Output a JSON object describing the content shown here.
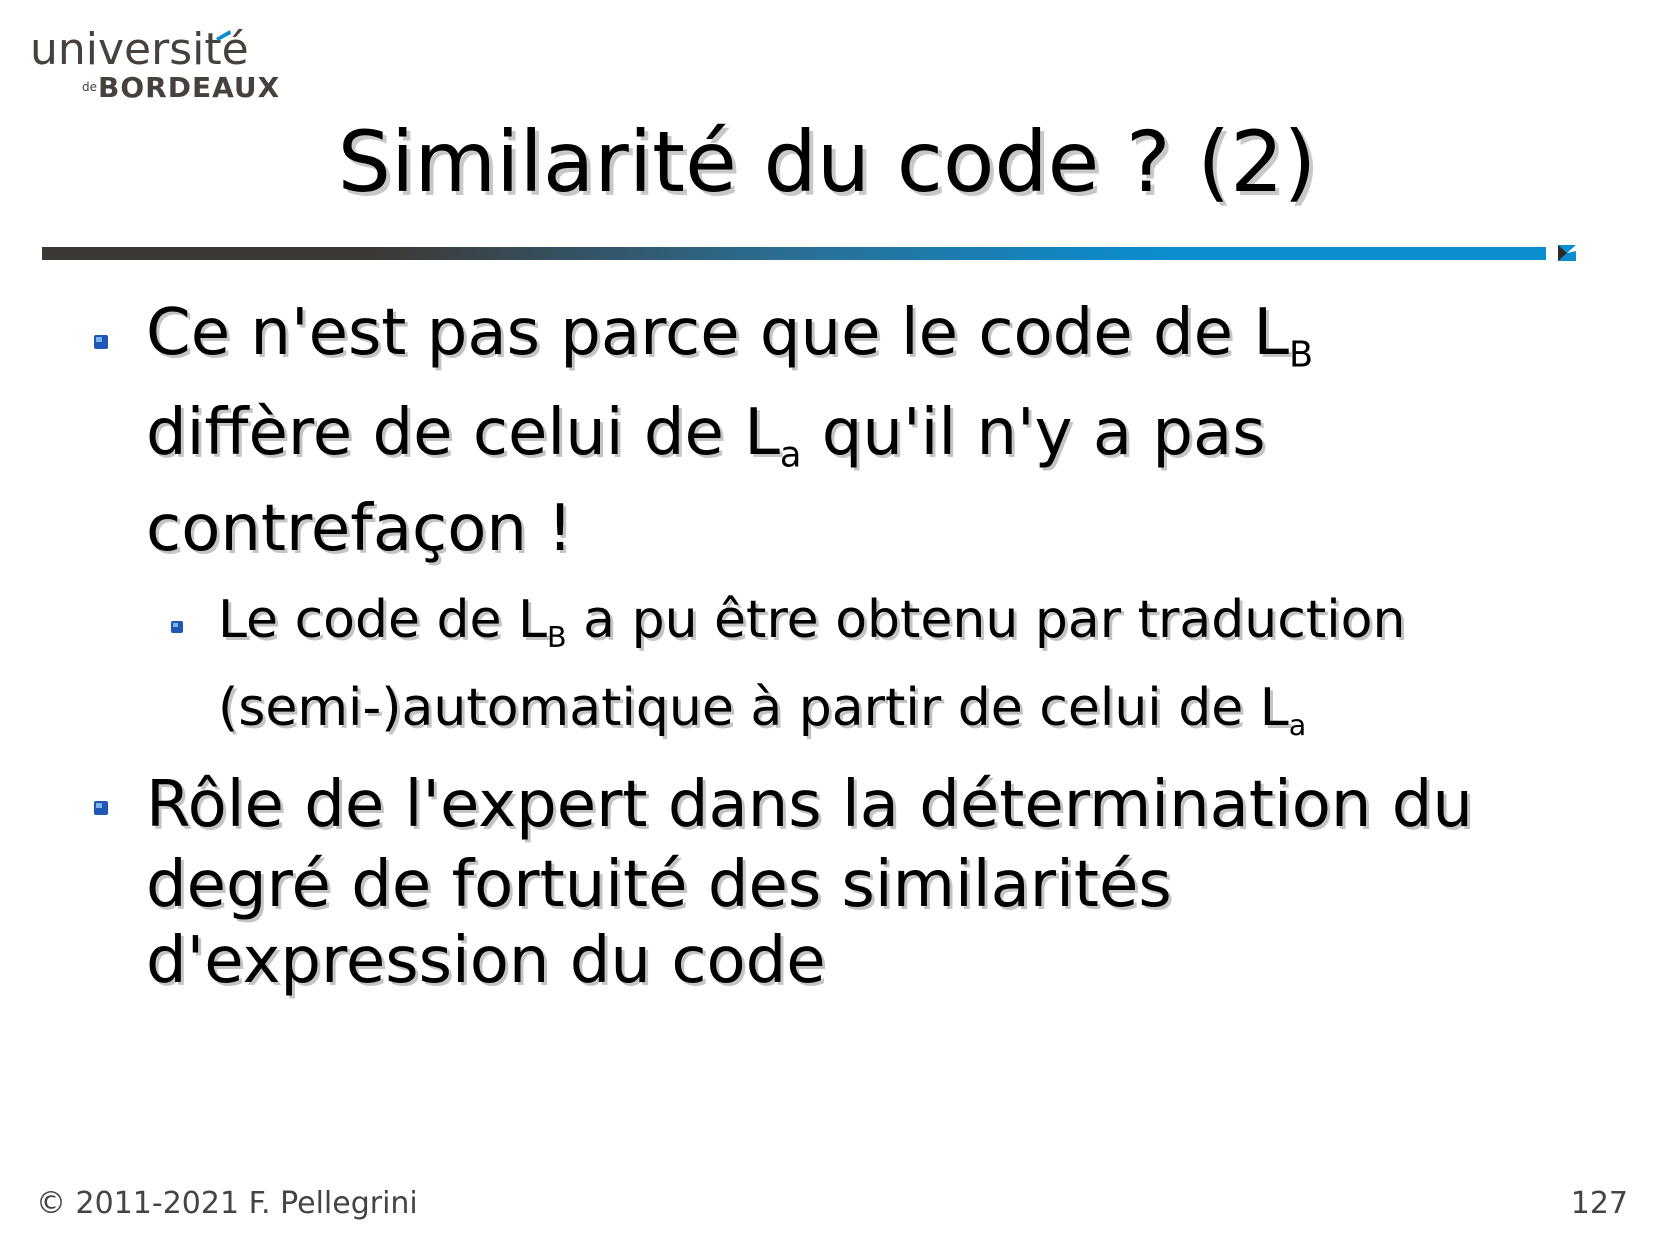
{
  "logo": {
    "line1": "université",
    "line2_small": "de",
    "line2": "BORDEAUX"
  },
  "title": "Similarité du code ? (2)",
  "bullets": [
    {
      "lines": [
        {
          "text": "Ce n'est pas parce que le code de L",
          "sub": "B",
          "after": ""
        },
        {
          "text": "diffère de celui de L",
          "sub": "a",
          "after": " qu'il n'y a pas"
        },
        {
          "text": "contrefaçon !",
          "sub": "",
          "after": ""
        }
      ],
      "sub_bullets": [
        {
          "lines": [
            {
              "text": "Le code de L",
              "sub": "B",
              "after": " a pu être obtenu par traduction"
            },
            {
              "text": "(semi-)automatique à partir de celui de L",
              "sub": "a",
              "after": ""
            }
          ]
        }
      ]
    },
    {
      "lines": [
        {
          "text": "Rôle de l'expert dans la détermination du",
          "sub": "",
          "after": ""
        },
        {
          "text": "degré de fortuité des similarités",
          "sub": "",
          "after": ""
        },
        {
          "text": "d'expression du code",
          "sub": "",
          "after": ""
        }
      ]
    }
  ],
  "footer": {
    "copyright": "© 2011-2021 F. Pellegrini",
    "page_number": "127"
  },
  "colors": {
    "accent_blue": "#0a8ed0",
    "brand_dark": "#47413d",
    "bullet_blue": "#1f57b5"
  }
}
